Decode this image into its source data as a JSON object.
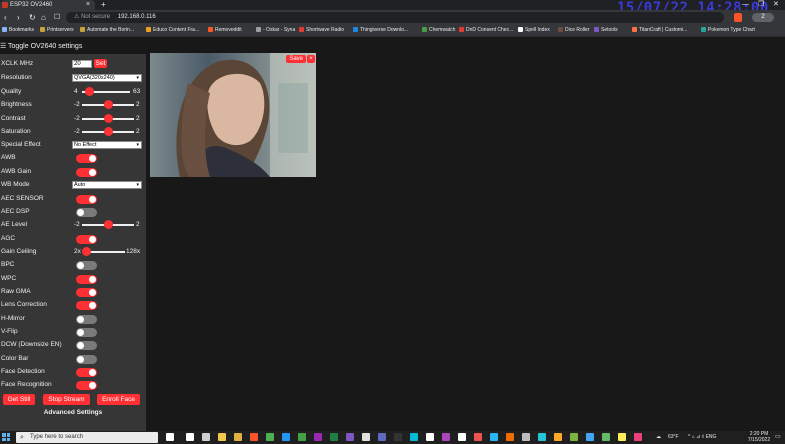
{
  "browser": {
    "tab_title": "ESP32 OV2460",
    "new_tab": "+",
    "window_controls": [
      "—",
      "❐",
      "✕"
    ],
    "overlay_datetime": "15/07/22 14:28:00",
    "url_security": "Not secure",
    "url_host": "192.168.0.116",
    "ext_badge": "2",
    "bookmarks": [
      {
        "label": "Bookmarks",
        "color": "#8ab4f8"
      },
      {
        "label": "Printservers",
        "color": "#c8a13a"
      },
      {
        "label": "Automate the Borin...",
        "color": "#c8a13a"
      },
      {
        "label": "Educo Content Fra...",
        "color": "#f0a020"
      },
      {
        "label": "Removeddit",
        "color": "#ff5722"
      },
      {
        "label": "- Oskar - Syna",
        "color": "#9e9e9e"
      },
      {
        "label": "Shortwave Radio",
        "color": "#e53935"
      },
      {
        "label": "Thingiverse Downlo...",
        "color": "#1e88e5"
      },
      {
        "label": "Chemwatch",
        "color": "#43a047"
      },
      {
        "label": "DnD Consent Chec...",
        "color": "#e53935"
      },
      {
        "label": "Spell Index",
        "color": "#ffffff"
      },
      {
        "label": "Dice Roller",
        "color": "#6d4c41"
      },
      {
        "label": "Setools",
        "color": "#7e57c2"
      },
      {
        "label": "TitanCraft | Customi...",
        "color": "#ff7043"
      },
      {
        "label": "Pokemon Type Chart",
        "color": "#26a69a"
      }
    ]
  },
  "page": {
    "toggle_label": "Toggle OV2640 settings",
    "xclk": {
      "label": "XCLK MHz",
      "value": "20",
      "set_label": "Set"
    },
    "resolution": {
      "label": "Resolution",
      "value": "QVGA(320x240)"
    },
    "sliders": [
      {
        "label": "Quality",
        "min": "4",
        "max": "63",
        "fraction": 0.15
      },
      {
        "label": "Brightness",
        "min": "-2",
        "max": "2",
        "fraction": 0.5
      },
      {
        "label": "Contrast",
        "min": "-2",
        "max": "2",
        "fraction": 0.5
      },
      {
        "label": "Saturation",
        "min": "-2",
        "max": "2",
        "fraction": 0.5
      }
    ],
    "special_effect": {
      "label": "Special Effect",
      "value": "No Effect"
    },
    "awb": {
      "label": "AWB",
      "on": true
    },
    "awb_gain": {
      "label": "AWB Gain",
      "on": true
    },
    "wb_mode": {
      "label": "WB Mode",
      "value": "Auto"
    },
    "aec_sensor": {
      "label": "AEC SENSOR",
      "on": true
    },
    "aec_dsp": {
      "label": "AEC DSP",
      "on": false
    },
    "ae_level": {
      "label": "AE Level",
      "min": "-2",
      "max": "2",
      "fraction": 0.5
    },
    "agc": {
      "label": "AGC",
      "on": true
    },
    "gain_ceiling": {
      "label": "Gain Ceiling",
      "min": "2x",
      "max": "128x",
      "fraction": 0.0
    },
    "toggles": [
      {
        "label": "BPC",
        "on": false
      },
      {
        "label": "WPC",
        "on": true
      },
      {
        "label": "Raw GMA",
        "on": true
      },
      {
        "label": "Lens Correction",
        "on": true
      },
      {
        "label": "H-Mirror",
        "on": false
      },
      {
        "label": "V-Flip",
        "on": false
      },
      {
        "label": "DCW (Downsize EN)",
        "on": false
      },
      {
        "label": "Color Bar",
        "on": false
      },
      {
        "label": "Face Detection",
        "on": true
      },
      {
        "label": "Face Recognition",
        "on": true
      }
    ],
    "buttons": {
      "get_still": "Get Still",
      "stop_stream": "Stop Stream",
      "enroll_face": "Enroll Face"
    },
    "advanced_settings": "Advanced Settings",
    "stream": {
      "save_label": "Save",
      "close_label": "×"
    }
  },
  "taskbar": {
    "search_placeholder": "Type here to search",
    "weather": "63°F",
    "tray_text": "^ ⌂ ⊿ ◊ ENG",
    "time": "2:20 PM",
    "date": "7/15/2022"
  }
}
